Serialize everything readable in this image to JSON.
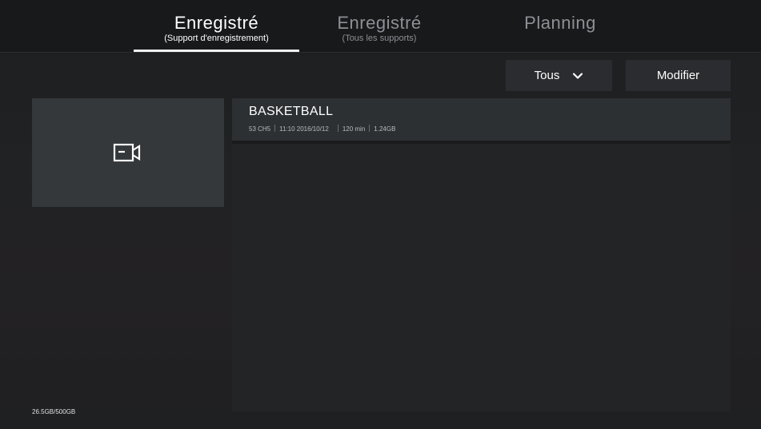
{
  "tabs": [
    {
      "title": "Enregistré",
      "subtitle": "(Support d'enregistrement)",
      "active": true
    },
    {
      "title": "Enregistré",
      "subtitle": "(Tous les supports)",
      "active": false
    },
    {
      "title": "Planning",
      "subtitle": "",
      "active": false
    }
  ],
  "toolbar": {
    "filter_label": "Tous",
    "modify_label": "Modifier"
  },
  "icons": {
    "thumbnail": "video-camera-icon",
    "filter_dropdown": "chevron-down-icon"
  },
  "recordings": [
    {
      "title": "BASKETBALL",
      "channel": "53 CH5",
      "datetime": "11:10 2016/10/12",
      "duration": "120 min",
      "size": "1.24GB"
    }
  ],
  "storage": {
    "usage": "26.5GB/500GB"
  },
  "colors": {
    "background": "#1f2123",
    "topbar": "#17191b",
    "panel": "#222426",
    "item": "#2d3033",
    "button": "#2a2c2f",
    "active_text": "#ffffff",
    "inactive_text": "#8d9094"
  }
}
